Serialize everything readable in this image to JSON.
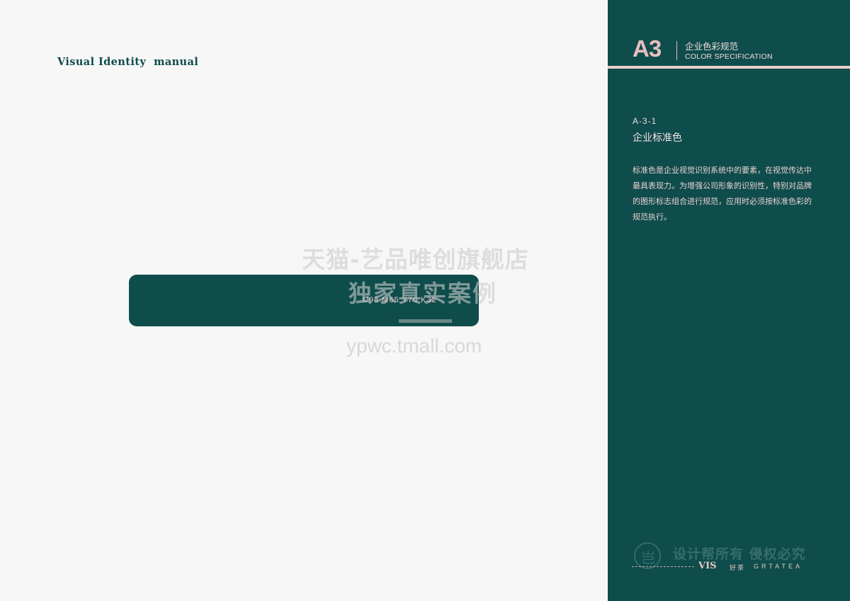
{
  "left": {
    "vi_title": "Visual Identity  manual",
    "swatch": {
      "color": "#0f4c4c",
      "code": "C98  M65  Y70  K32"
    },
    "watermark": {
      "line1": "天猫-艺品唯创旗舰店",
      "line2": "独家真实案例",
      "url": "ypwc.tmall.com"
    }
  },
  "right": {
    "background": "#0f4c4c",
    "accent": "#e8bfbe",
    "header": {
      "code": "A3",
      "title_cn": "企业色彩规范",
      "title_en": "COLOR SPECIFICATION"
    },
    "section": {
      "number": "A-3-1",
      "title": "企业标准色",
      "description": "标准色是企业视觉识别系统中的要素，在视觉传达中最具表现力。为增强公司形象的识别性，特别对品牌的图形标志组合进行规范，应用时必须按标准色彩的规范执行。"
    },
    "footer": {
      "watermark_text": "设计帮所有 侵权必究",
      "watermark_icon_glyph": "岂",
      "vis_label": "VIS",
      "brand_cn": "好茶",
      "brand_en": "GRTATEA"
    }
  }
}
